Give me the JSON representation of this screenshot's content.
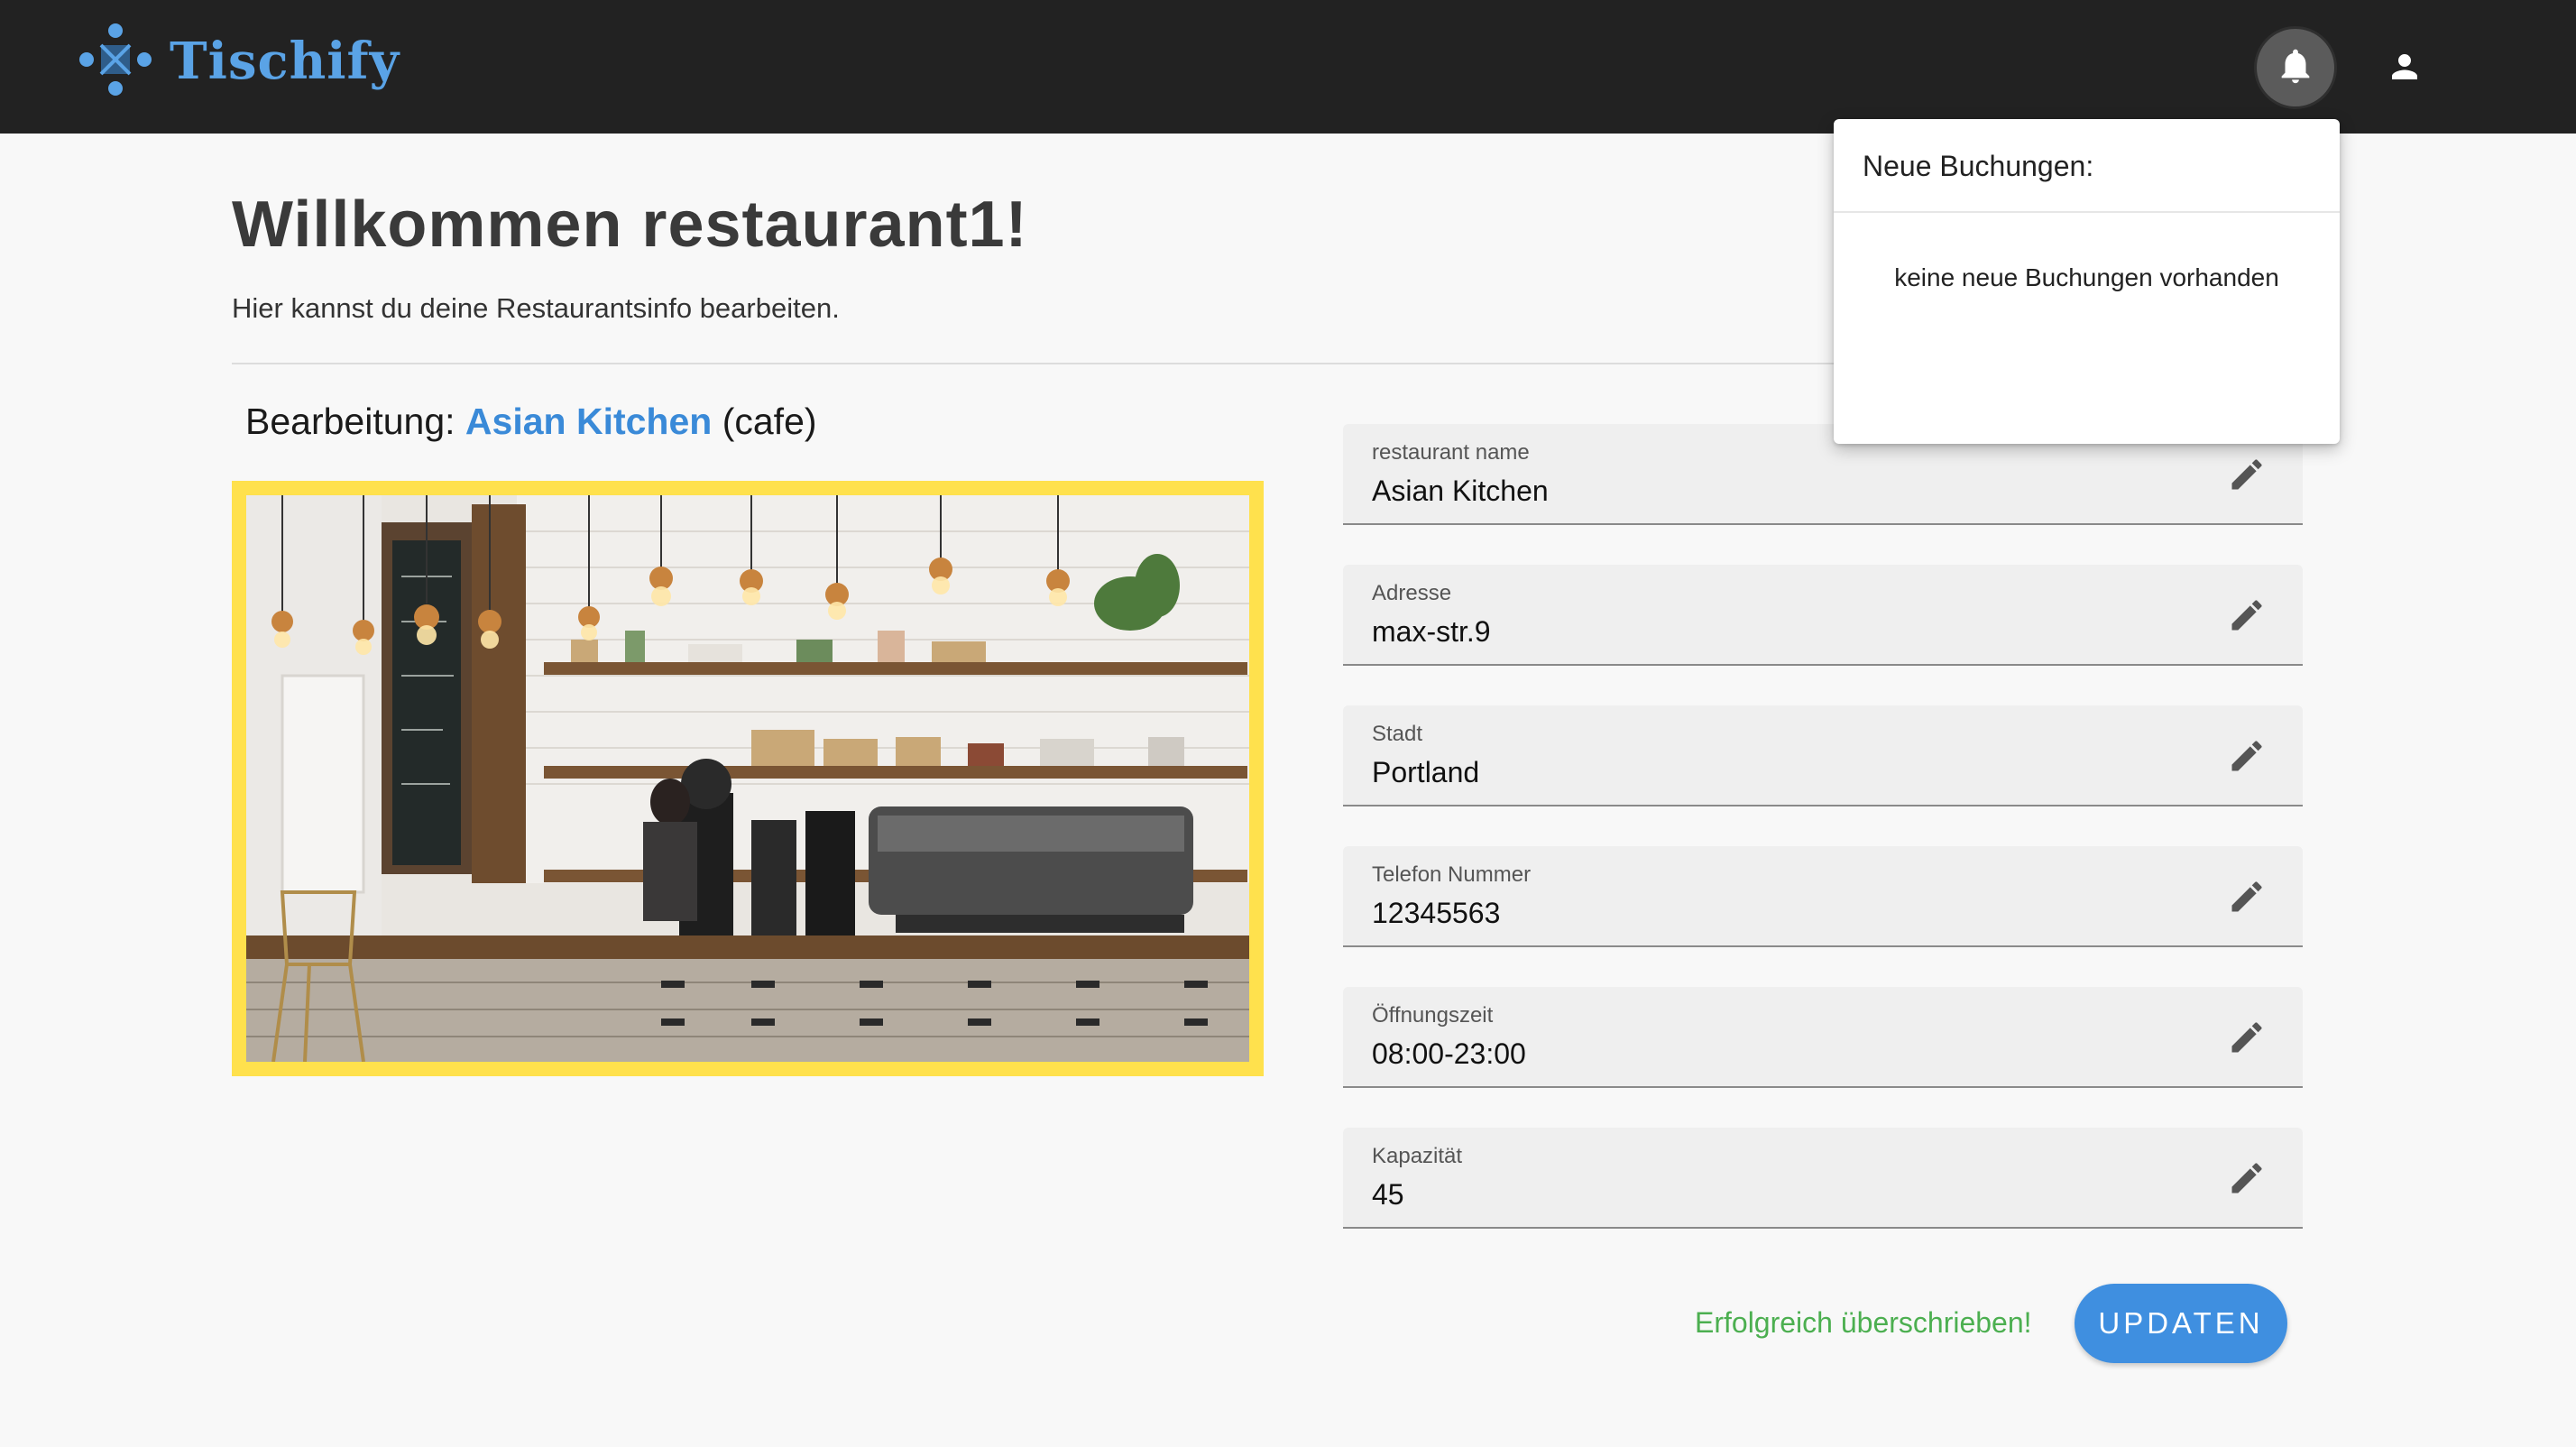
{
  "header": {
    "app_name": "Tischify",
    "logo_icon": "tischify-logo-icon",
    "bell_icon": "bell-icon",
    "user_icon": "user-icon"
  },
  "welcome": {
    "title": "Willkommen restaurant1!",
    "subtitle": "Hier kannst du deine Restaurantsinfo bearbeiten."
  },
  "edit": {
    "prefix": "Bearbeitung:",
    "restaurant_name": "Asian Kitchen",
    "type": "(cafe)"
  },
  "fields": [
    {
      "label": "restaurant name",
      "value": "Asian Kitchen"
    },
    {
      "label": "Adresse",
      "value": "max-str.9"
    },
    {
      "label": "Stadt",
      "value": "Portland"
    },
    {
      "label": "Telefon Nummer",
      "value": "12345563"
    },
    {
      "label": "Öffnungszeit",
      "value": "08:00-23:00"
    },
    {
      "label": "Kapazität",
      "value": "45"
    }
  ],
  "actions": {
    "success_message": "Erfolgreich überschrieben!",
    "update_label": "UPDATEN"
  },
  "notifications": {
    "title": "Neue Buchungen:",
    "empty_message": "keine neue Buchungen vorhanden"
  },
  "colors": {
    "topbar": "#222222",
    "brand": "#5aa3e6",
    "accent": "#3f8fe0",
    "success": "#4caf50",
    "photo_frame": "#ffe14d"
  }
}
